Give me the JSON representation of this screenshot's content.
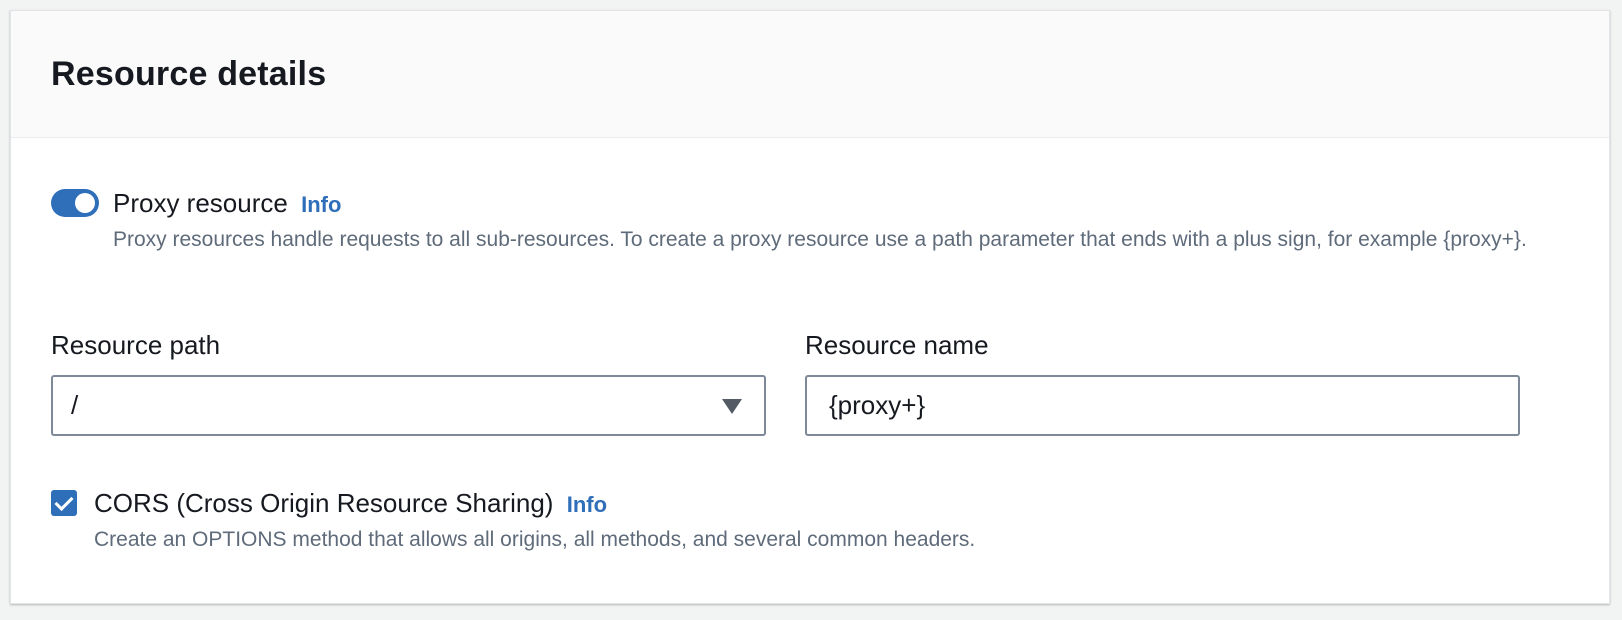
{
  "panel": {
    "title": "Resource details"
  },
  "proxy_resource": {
    "label": "Proxy resource",
    "info_link": "Info",
    "enabled": true,
    "description": "Proxy resources handle requests to all sub-resources. To create a proxy resource use a path parameter that ends with a plus sign, for example {proxy+}."
  },
  "resource_path": {
    "label": "Resource path",
    "selected_value": "/"
  },
  "resource_name": {
    "label": "Resource name",
    "value": "{proxy+}"
  },
  "cors": {
    "label": "CORS (Cross Origin Resource Sharing)",
    "info_link": "Info",
    "checked": true,
    "description": "Create an OPTIONS method that allows all origins, all methods, and several common headers."
  },
  "colors": {
    "accent": "#2f6eb8",
    "text": "#16191f",
    "muted_text": "#5f6b7a",
    "border": "#7d8998"
  },
  "icons": {
    "toggle": "toggle-switch-on",
    "caret": "caret-down-icon",
    "checkbox": "checkmark-icon"
  }
}
